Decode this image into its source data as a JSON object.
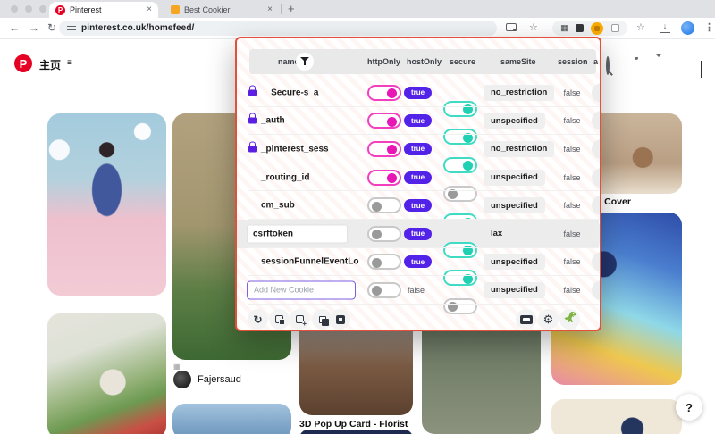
{
  "browser": {
    "tabs": [
      {
        "title": "Pinterest",
        "close": "×"
      },
      {
        "title": "Best Cookier",
        "close": "×"
      }
    ],
    "new_tab_label": "+",
    "url": "pinterest.co.uk/homefeed/",
    "nav": {
      "back": "←",
      "forward": "→",
      "reload": "↻",
      "menu": "⋮",
      "bookmark_star": "☆",
      "side_panel_star": "☆",
      "download": "↓",
      "ext_grid": "▦"
    }
  },
  "pinterest": {
    "home_label": "主页",
    "home_menu_glyph": "≡",
    "creator_name": "Fajersaud",
    "carousel_glyph": "▦",
    "pin_title_florist": "3D Pop Up Card - Florist",
    "pin_title_book": "Book Cover",
    "help_label": "?"
  },
  "cookie_editor": {
    "header": {
      "name": "name",
      "httpOnly": "httpOnly",
      "hostOnly": "hostOnly",
      "secure": "secure",
      "sameSite": "sameSite",
      "session": "session",
      "partial": "a"
    },
    "rows": [
      {
        "name": "__Secure-s_a",
        "locked": true,
        "httpOnly": "on",
        "hostOnly": "true",
        "secure": "on",
        "sameSite": "no_restriction",
        "session": "false"
      },
      {
        "name": "_auth",
        "locked": true,
        "httpOnly": "on",
        "hostOnly": "true",
        "secure": "on",
        "sameSite": "unspecified",
        "session": "false"
      },
      {
        "name": "_pinterest_sess",
        "locked": true,
        "httpOnly": "on",
        "hostOnly": "true",
        "secure": "on",
        "sameSite": "no_restriction",
        "session": "false"
      },
      {
        "name": "_routing_id",
        "locked": false,
        "httpOnly": "on",
        "hostOnly": "true",
        "secure": "off",
        "sameSite": "unspecified",
        "session": "false"
      },
      {
        "name": "cm_sub",
        "locked": false,
        "httpOnly": "off",
        "hostOnly": "true",
        "secure": "on",
        "sameSite": "unspecified",
        "session": "false"
      },
      {
        "name": "csrftoken",
        "locked": false,
        "editing": true,
        "highlighted": true,
        "httpOnly": "off",
        "hostOnly": "true",
        "secure": "on",
        "sameSite": "lax",
        "session": "false"
      },
      {
        "name": "sessionFunnelEventLo",
        "locked": false,
        "httpOnly": "off",
        "hostOnly": "true",
        "secure": "on",
        "sameSite": "unspecified",
        "session": "false"
      },
      {
        "name": "",
        "placeholder": "Add New Cookie",
        "new_row": true,
        "httpOnly": "off",
        "hostOnly": "false",
        "secure": "off",
        "sameSite": "unspecified",
        "session": "false"
      }
    ],
    "toolbar_left_icons": [
      "refresh",
      "import",
      "export",
      "copy",
      "delete"
    ],
    "toolbar_right_icons": [
      "screencast",
      "settings",
      "dinosaur"
    ],
    "colors": {
      "border": "#e2503a",
      "toggle_pink": "#e716b4",
      "toggle_teal": "#1fd0b3",
      "badge_purple": "#5222e8"
    }
  }
}
